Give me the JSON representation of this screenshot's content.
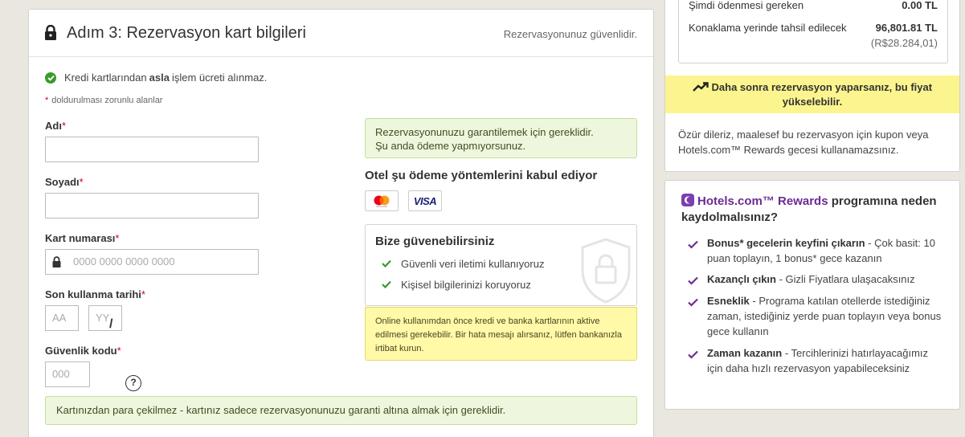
{
  "header": {
    "title": "Adım 3: Rezervasyon kart bilgileri",
    "secure_text": "Rezervasyonunuz güvenlidir."
  },
  "no_fee": {
    "before": "Kredi kartlarından",
    "bold": "asla",
    "after": "işlem ücreti alınmaz."
  },
  "required_note": {
    "star": "*",
    "text": "doldurulması zorunlu alanlar"
  },
  "form": {
    "first_name_label": "Adı",
    "last_name_label": "Soyadı",
    "card_number_label": "Kart numarası",
    "card_number_placeholder": "0000 0000 0000 0000",
    "expiry_label": "Son kullanma tarihi",
    "expiry_month_placeholder": "AA",
    "expiry_separator": "/",
    "expiry_year_placeholder": "YY",
    "cvv_label": "Güvenlik kodu",
    "cvv_placeholder": "000",
    "required_mark": "*",
    "help_symbol": "?"
  },
  "guarantee_box": {
    "line1": "Rezervasyonunuzu garantilemek için gereklidir.",
    "line2": "Şu anda ödeme yapmıyorsunuz."
  },
  "payment_methods": {
    "title": "Otel şu ödeme yöntemlerini kabul ediyor",
    "cards": [
      "mastercard-icon",
      "VISA"
    ]
  },
  "trust": {
    "title": "Bize güvenebilirsiniz",
    "items": [
      "Güvenli veri iletimi kullanıyoruz",
      "Kişisel bilgilerinizi koruyoruz"
    ]
  },
  "activation_note": "Online kullanımdan önce kredi ve banka kartlarının aktive edilmesi gerekebilir. Bir hata mesajı alırsanız, lütfen bankanızla irtibat kurun.",
  "bottom_note": "Kartınızdan para çekilmez - kartınız sadece rezervasyonunuzu garanti altına almak için gereklidir.",
  "summary": {
    "due_now_label": "Şimdi ödenmesi gereken",
    "due_now_value": "0.00 TL",
    "hotel_label": "Konaklama yerinde tahsil edilecek",
    "hotel_value": "96,801.81 TL",
    "hotel_value_alt": "(R$28.284,01)",
    "price_banner": "Daha sonra rezervasyon yaparsanız, bu fiyat yükselebilir.",
    "coupon_note": "Özür dileriz, maalesef bu rezervasyon için kupon veya Hotels.com™ Rewards gecesi kullanamazsınız."
  },
  "rewards": {
    "brand": "Hotels.com™ Rewards",
    "title_rest": "programına neden kaydolmalısınız?",
    "benefits": [
      {
        "bold": "Bonus* gecelerin keyfini çıkarın",
        "text": " - Çok basit: 10 puan toplayın, 1 bonus* gece kazanın"
      },
      {
        "bold": "Kazançlı çıkın",
        "text": " - Gizli Fiyatlara ulaşacaksınız"
      },
      {
        "bold": "Esneklik",
        "text": " - Programa katılan otellerde istediğiniz zaman, istediğiniz yerde puan toplayın veya bonus gece kullanın"
      },
      {
        "bold": "Zaman kazanın",
        "text": " - Tercihlerinizi hatırlayacağımız için daha hızlı rezervasyon yapabileceksiniz"
      }
    ]
  },
  "colors": {
    "success_green": "#3a9a2c",
    "required_red": "#d0021b",
    "rewards_purple": "#6b2c91",
    "banner_yellow": "#fcf58f"
  }
}
